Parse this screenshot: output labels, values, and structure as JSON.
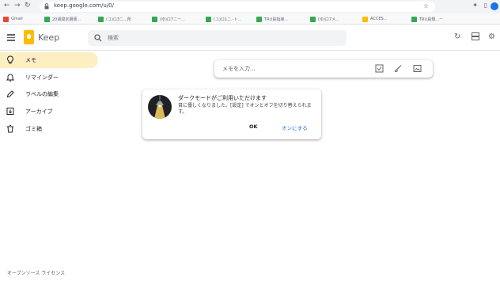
{
  "browser": {
    "url": "keep.google.com/u/0/",
    "bookmarks": [
      {
        "label": "Gmail"
      },
      {
        "label": "20週間定期便..."
      },
      {
        "label": "(ユ)ロ3ニ...所"
      },
      {
        "label": "(ゆ)ロ7ニー..."
      },
      {
        "label": "(ユ)ロ1ニ.-ト..."
      },
      {
        "label": "TRU員指導..."
      },
      {
        "label": "(ゆ)ロ7メ..."
      },
      {
        "label": "ACCES..."
      },
      {
        "label": "TRU員規...ー"
      }
    ]
  },
  "header": {
    "app_name": "Keep",
    "search_placeholder": "検索"
  },
  "sidebar": {
    "items": [
      {
        "label": "メモ",
        "active": true,
        "icon": "lightbulb-icon"
      },
      {
        "label": "リマインダー",
        "active": false,
        "icon": "bell-icon"
      },
      {
        "label": "ラベルの編集",
        "active": false,
        "icon": "pencil-icon"
      },
      {
        "label": "アーカイブ",
        "active": false,
        "icon": "archive-icon"
      },
      {
        "label": "ゴミ箱",
        "active": false,
        "icon": "trash-icon"
      }
    ],
    "footer": "オープンソース ライセンス"
  },
  "note_input": {
    "placeholder": "メモを入力..."
  },
  "dark_mode_card": {
    "title": "ダークモードがご利用いただけます",
    "body": "目に優しくなりました。[設定] でオンとオフを切り替えられます。",
    "ok_label": "OK",
    "enable_label": "オンにする"
  },
  "colors": {
    "accent": "#fbbc04",
    "active_bg": "#feefc3",
    "link": "#1a73e8"
  }
}
